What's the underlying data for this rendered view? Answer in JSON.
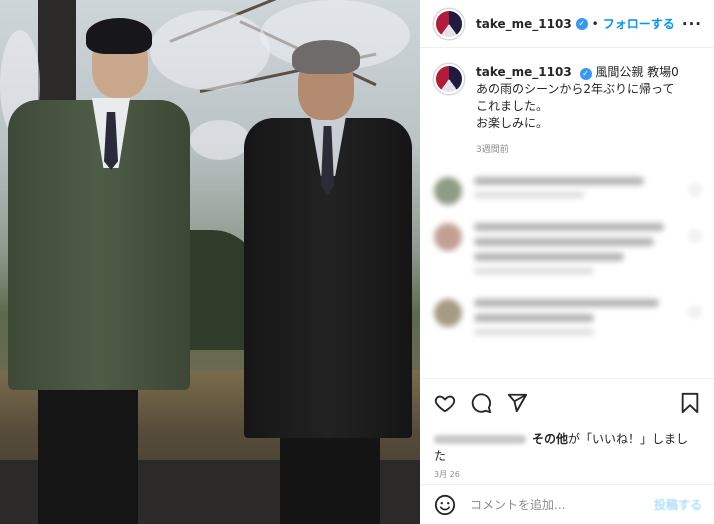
{
  "header": {
    "username": "take_me_1103",
    "follow_label": "フォローする",
    "more_icon": "more-horizontal-icon"
  },
  "caption": {
    "username": "take_me_1103",
    "tags": "風間公親 教場0",
    "lines": [
      "あの雨のシーンから2年ぶりに帰って",
      "これました。",
      "お楽しみに。"
    ],
    "time": "3週間前"
  },
  "actions": {
    "icons": [
      "heart-icon",
      "comment-icon",
      "share-icon",
      "bookmark-icon"
    ],
    "likes_text_bold": "その他",
    "likes_text": "が「いいね！」しました",
    "date": "3月 26"
  },
  "comment_bar": {
    "placeholder": "コメントを追加...",
    "post_label": "投稿する",
    "emoji_icon": "emoji-icon"
  },
  "colors": {
    "accent": "#0095f6",
    "verified": "#3897f0",
    "muted": "#8e8e8e"
  }
}
